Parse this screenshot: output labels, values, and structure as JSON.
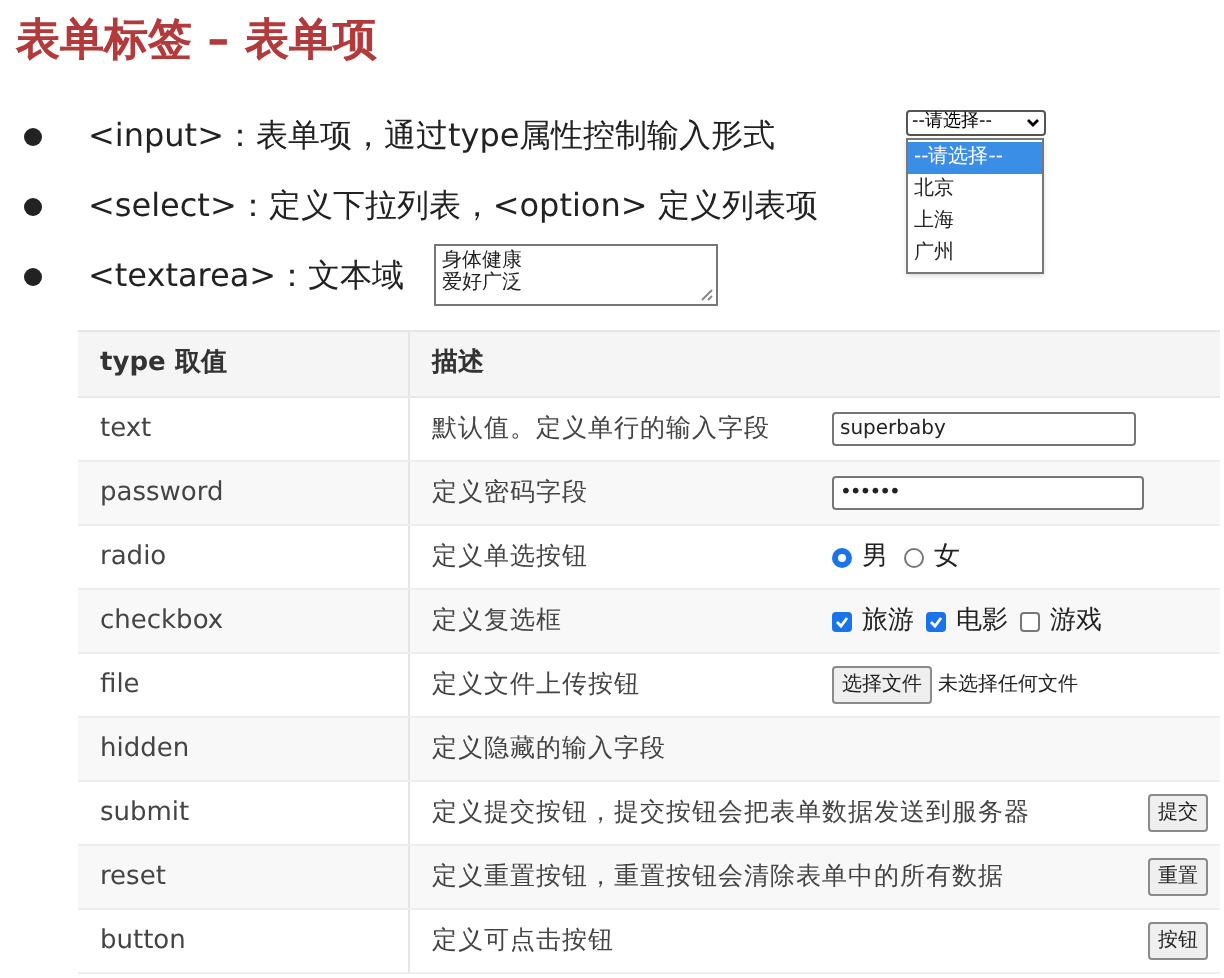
{
  "title": "表单标签 – 表单项",
  "bullets": [
    {
      "tag": "<input>",
      "text": "：表单项，通过type属性控制输入形式"
    },
    {
      "tag": "<select>",
      "text": "：定义下拉列表，<option> 定义列表项"
    },
    {
      "tag": "<textarea>",
      "text": "：文本域"
    }
  ],
  "select": {
    "value": "--请选择--",
    "expanded": true,
    "options": [
      {
        "label": "--请选择--",
        "selected": true
      },
      {
        "label": "北京",
        "selected": false
      },
      {
        "label": "上海",
        "selected": false
      },
      {
        "label": "广州",
        "selected": false
      }
    ]
  },
  "textarea": {
    "lines": [
      "身体健康",
      "爱好广泛"
    ]
  },
  "table": {
    "columns": [
      "type 取值",
      "描述"
    ],
    "rows": [
      {
        "type": "text",
        "description": "默认值。定义单行的输入字段",
        "control": {
          "kind": "text",
          "value": "superbaby"
        }
      },
      {
        "type": "password",
        "description": "定义密码字段",
        "control": {
          "kind": "password",
          "value": "••••••"
        }
      },
      {
        "type": "radio",
        "description": "定义单选按钮",
        "control": {
          "kind": "radio",
          "options": [
            {
              "label": "男",
              "selected": true
            },
            {
              "label": "女",
              "selected": false
            }
          ]
        }
      },
      {
        "type": "checkbox",
        "description": "定义复选框",
        "control": {
          "kind": "checkbox",
          "options": [
            {
              "label": "旅游",
              "checked": true
            },
            {
              "label": "电影",
              "checked": true
            },
            {
              "label": "游戏",
              "checked": false
            }
          ]
        }
      },
      {
        "type": "file",
        "description": "定义文件上传按钮",
        "control": {
          "kind": "file",
          "button": "选择文件",
          "status": "未选择任何文件"
        }
      },
      {
        "type": "hidden",
        "description": "定义隐藏的输入字段"
      },
      {
        "type": "submit",
        "description": "定义提交按钮，提交按钮会把表单数据发送到服务器",
        "control": {
          "kind": "button",
          "label": "提交"
        }
      },
      {
        "type": "reset",
        "description": "定义重置按钮，重置按钮会清除表单中的所有数据",
        "control": {
          "kind": "button",
          "label": "重置"
        }
      },
      {
        "type": "button",
        "description": "定义可点击按钮",
        "control": {
          "kind": "button",
          "label": "按钮"
        }
      }
    ]
  }
}
